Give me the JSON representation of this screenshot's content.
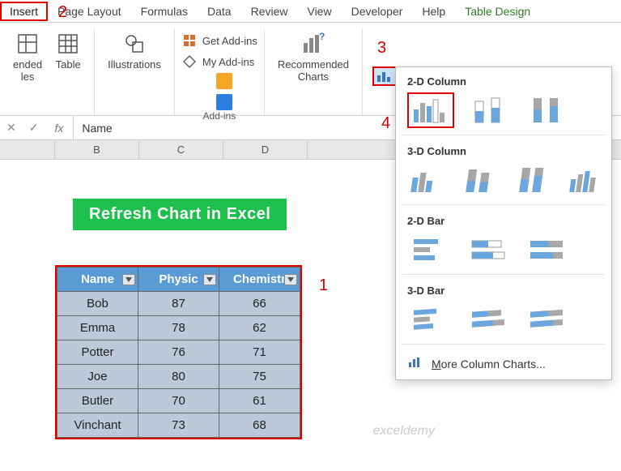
{
  "ribbon": {
    "tabs": [
      "Insert",
      "Page Layout",
      "Formulas",
      "Data",
      "Review",
      "View",
      "Developer",
      "Help",
      "Table Design"
    ],
    "groups": {
      "tables": {
        "pivot": "ended",
        "pivot2": "les",
        "table": "Table"
      },
      "illustrations": "Illustrations",
      "addins": {
        "get": "Get Add-ins",
        "my": "My Add-ins",
        "group_label": "Add-ins"
      },
      "charts": {
        "recommended": "Recommended",
        "charts": "Charts"
      }
    }
  },
  "formula_bar": {
    "x": "✕",
    "chk": "✓",
    "fx": "fx",
    "content": "Name"
  },
  "columns": [
    "B",
    "C",
    "D"
  ],
  "banner": "Refresh Chart in Excel",
  "table": {
    "headers": [
      "Name",
      "Physic",
      "Chemistr"
    ],
    "rows": [
      {
        "name": "Bob",
        "physics": "87",
        "chemistry": "66"
      },
      {
        "name": "Emma",
        "physics": "78",
        "chemistry": "62"
      },
      {
        "name": "Potter",
        "physics": "76",
        "chemistry": "71"
      },
      {
        "name": "Joe",
        "physics": "80",
        "chemistry": "75"
      },
      {
        "name": "Butler",
        "physics": "70",
        "chemistry": "61"
      },
      {
        "name": "Vinchant",
        "physics": "73",
        "chemistry": "68"
      }
    ]
  },
  "chart_panel": {
    "sections": {
      "col2d": "2-D Column",
      "col3d": "3-D Column",
      "bar2d": "2-D Bar",
      "bar3d": "3-D Bar"
    },
    "more": "More Column Charts..."
  },
  "annotations": {
    "n1": "1",
    "n2": "2",
    "n3": "3",
    "n4": "4"
  },
  "watermark": "exceldemy"
}
